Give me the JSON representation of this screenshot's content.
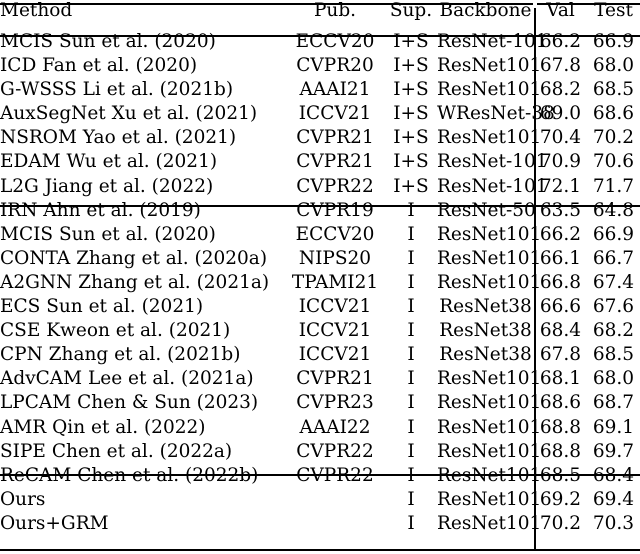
{
  "table": {
    "columns": [
      {
        "key": "method",
        "label": "Method"
      },
      {
        "key": "pub",
        "label": "Pub."
      },
      {
        "key": "sup",
        "label": "Sup."
      },
      {
        "key": "backbone",
        "label": "Backbone"
      },
      {
        "key": "val",
        "label": "Val"
      },
      {
        "key": "test",
        "label": "Test"
      }
    ],
    "sections": [
      {
        "rows": [
          {
            "method": "MCIS Sun et al. (2020)",
            "pub": "ECCV20",
            "sup": "I+S",
            "backbone": "ResNet-101",
            "val": "66.2",
            "test": "66.9",
            "bold": false
          },
          {
            "method": "ICD Fan et al. (2020)",
            "pub": "CVPR20",
            "sup": "I+S",
            "backbone": "ResNet101",
            "val": "67.8",
            "test": "68.0",
            "bold": false
          },
          {
            "method": "G-WSSS Li et al. (2021b)",
            "pub": "AAAI21",
            "sup": "I+S",
            "backbone": "ResNet101",
            "val": "68.2",
            "test": "68.5",
            "bold": false
          },
          {
            "method": "AuxSegNet Xu et al. (2021)",
            "pub": "ICCV21",
            "sup": "I+S",
            "backbone": "WResNet-38",
            "val": "69.0",
            "test": "68.6",
            "bold": false
          },
          {
            "method": "NSROM Yao et al. (2021)",
            "pub": "CVPR21",
            "sup": "I+S",
            "backbone": "ResNet101",
            "val": "70.4",
            "test": "70.2",
            "bold": false
          },
          {
            "method": "EDAM Wu et al. (2021)",
            "pub": "CVPR21",
            "sup": "I+S",
            "backbone": "ResNet-101",
            "val": "70.9",
            "test": "70.6",
            "bold": false
          },
          {
            "method": "L2G Jiang et al. (2022)",
            "pub": "CVPR22",
            "sup": "I+S",
            "backbone": "ResNet-101",
            "val": "72.1",
            "test": "71.7",
            "bold": false
          }
        ]
      },
      {
        "rows": [
          {
            "method": "IRN Ahn et al. (2019)",
            "pub": "CVPR19",
            "sup": "I",
            "backbone": "ResNet-50",
            "val": "63.5",
            "test": "64.8",
            "bold": false
          },
          {
            "method": "MCIS Sun et al. (2020)",
            "pub": "ECCV20",
            "sup": "I",
            "backbone": "ResNet101",
            "val": "66.2",
            "test": "66.9",
            "bold": false
          },
          {
            "method": "CONTA Zhang et al. (2020a)",
            "pub": "NIPS20",
            "sup": "I",
            "backbone": "ResNet101",
            "val": "66.1",
            "test": "66.7",
            "bold": false
          },
          {
            "method": "A2GNN Zhang et al. (2021a)",
            "pub": "TPAMI21",
            "sup": "I",
            "backbone": "ResNet101",
            "val": "66.8",
            "test": "67.4",
            "bold": false
          },
          {
            "method": "ECS Sun et al. (2021)",
            "pub": "ICCV21",
            "sup": "I",
            "backbone": "ResNet38",
            "val": "66.6",
            "test": "67.6",
            "bold": false
          },
          {
            "method": "CSE Kweon et al. (2021)",
            "pub": "ICCV21",
            "sup": "I",
            "backbone": "ResNet38",
            "val": "68.4",
            "test": "68.2",
            "bold": false
          },
          {
            "method": "CPN Zhang et al. (2021b)",
            "pub": "ICCV21",
            "sup": "I",
            "backbone": "ResNet38",
            "val": "67.8",
            "test": "68.5",
            "bold": false
          },
          {
            "method": "AdvCAM Lee et al. (2021a)",
            "pub": "CVPR21",
            "sup": "I",
            "backbone": "ResNet101",
            "val": "68.1",
            "test": "68.0",
            "bold": false
          },
          {
            "method": "LPCAM Chen & Sun (2023)",
            "pub": "CVPR23",
            "sup": "I",
            "backbone": "ResNet101",
            "val": "68.6",
            "test": "68.7",
            "bold": false
          },
          {
            "method": "AMR Qin et al. (2022)",
            "pub": "AAAI22",
            "sup": "I",
            "backbone": "ResNet101",
            "val": "68.8",
            "test": "69.1",
            "bold": false
          },
          {
            "method": "SIPE Chen et al. (2022a)",
            "pub": "CVPR22",
            "sup": "I",
            "backbone": "ResNet101",
            "val": "68.8",
            "test": "69.7",
            "bold": false
          }
        ]
      },
      {
        "rows": [
          {
            "method": "ReCAM Chen et al. (2022b)",
            "pub": "CVPR22",
            "sup": "I",
            "backbone": "ResNet101",
            "val": "68.5",
            "test": "68.4",
            "bold": false
          },
          {
            "method": "Ours",
            "pub": "",
            "sup": "I",
            "backbone": "ResNet101",
            "val": "69.2",
            "test": "69.4",
            "bold": false
          },
          {
            "method": "Ours+GRM",
            "pub": "",
            "sup": "I",
            "backbone": "ResNet101",
            "val": "70.2",
            "test": "70.3",
            "bold": true
          }
        ]
      }
    ]
  }
}
